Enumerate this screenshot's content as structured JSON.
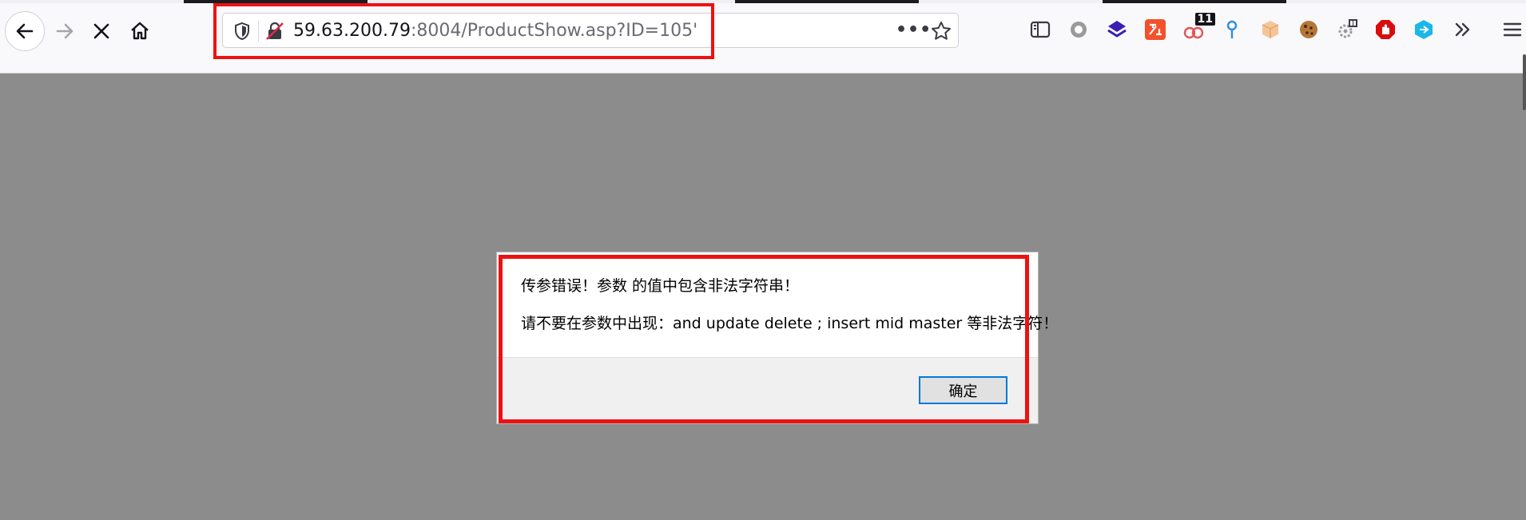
{
  "browser": {
    "url_host": "59.63.200.79",
    "url_rest": ":8004/ProductShow.asp?ID=105'",
    "page_actions_label": "•••",
    "extensions": [
      {
        "name": "sidebar-icon"
      },
      {
        "name": "circle-icon"
      },
      {
        "name": "layers-icon"
      },
      {
        "name": "translate-icon"
      },
      {
        "name": "extension-counter-icon",
        "badge": "11"
      },
      {
        "name": "pin-icon"
      },
      {
        "name": "box-icon"
      },
      {
        "name": "cookie-icon"
      },
      {
        "name": "gear-extension-icon"
      },
      {
        "name": "stop-sign-icon"
      },
      {
        "name": "cube-icon"
      },
      {
        "name": "overflow-chevrons-icon"
      },
      {
        "name": "hamburger-menu-icon"
      }
    ]
  },
  "dialog": {
    "line1": "传参错误！参数  的值中包含非法字符串！",
    "line2": "请不要在参数中出现：and update delete ; insert mid master 等非法字符！",
    "ok_label": "确定"
  }
}
